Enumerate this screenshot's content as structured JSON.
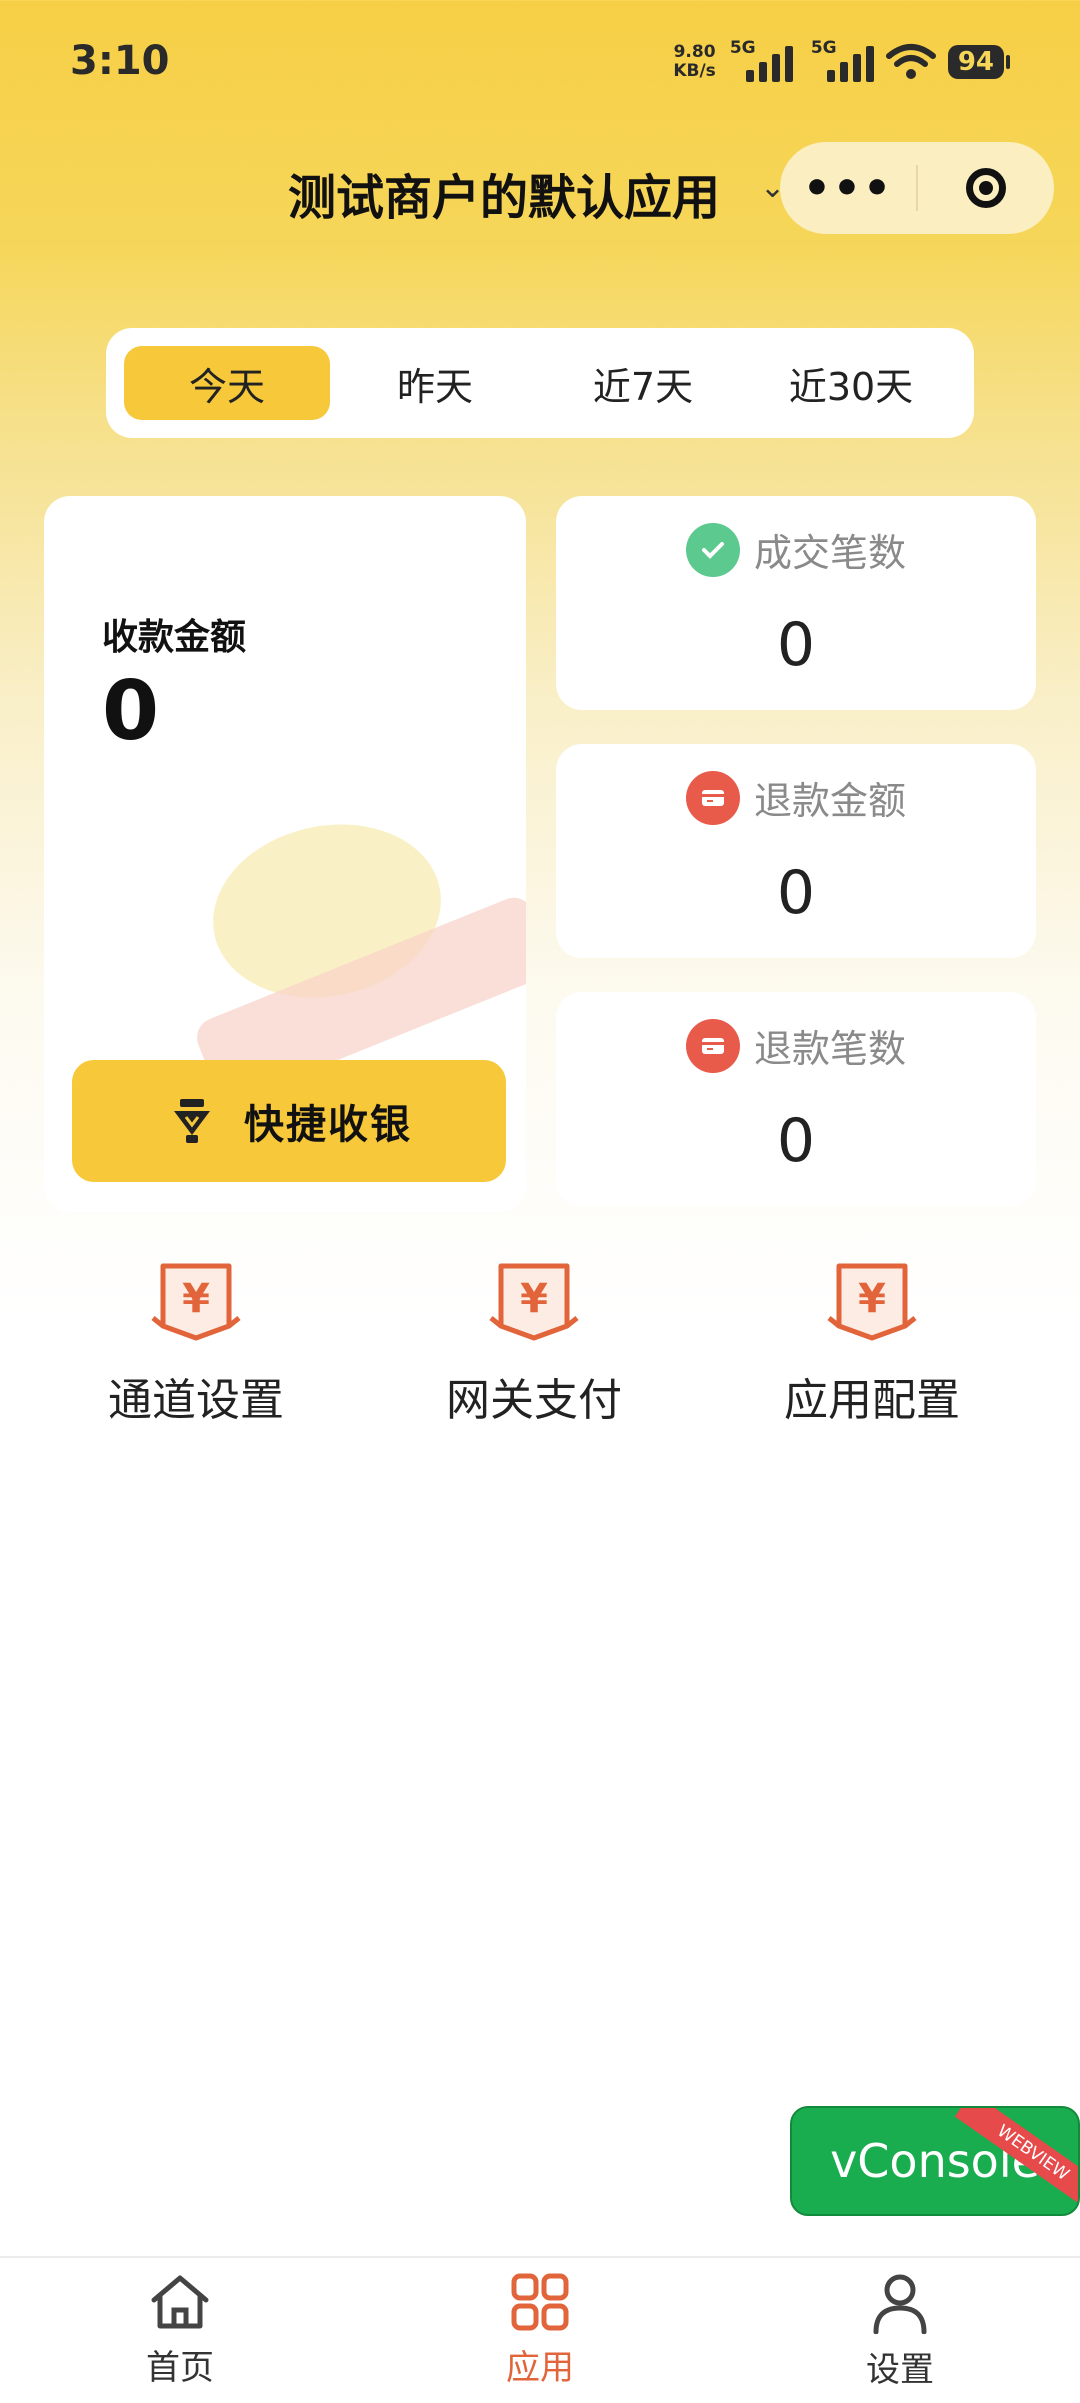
{
  "status_bar": {
    "time": "3:10",
    "net_speed_value": "9.80",
    "net_speed_unit": "KB/s",
    "signal1_tag": "5G",
    "signal2_tag": "5G",
    "battery": "94"
  },
  "header": {
    "title": "测试商户的默认应用",
    "more_icon": "more-dots-icon",
    "close_icon": "target-icon"
  },
  "tabs": {
    "items": [
      "今天",
      "昨天",
      "近7天",
      "近30天"
    ],
    "active_index": 0
  },
  "summary": {
    "amount_label": "收款金额",
    "amount_value": "0",
    "quick_cashier_label": "快捷收银",
    "cards": [
      {
        "label": "成交笔数",
        "value": "0",
        "icon": "check-circle-icon",
        "color": "#5cc98f"
      },
      {
        "label": "退款金额",
        "value": "0",
        "icon": "refund-card-icon",
        "color": "#e85a4a"
      },
      {
        "label": "退款笔数",
        "value": "0",
        "icon": "refund-card-icon",
        "color": "#e85a4a"
      }
    ]
  },
  "shortcuts": [
    {
      "label": "通道设置",
      "icon": "yuan-tag-icon"
    },
    {
      "label": "网关支付",
      "icon": "yuan-tag-icon"
    },
    {
      "label": "应用配置",
      "icon": "yuan-tag-icon"
    }
  ],
  "vconsole": {
    "label": "vConsole",
    "ribbon": "WEBVIEW"
  },
  "bottom_nav": {
    "items": [
      {
        "label": "首页",
        "icon": "home-icon"
      },
      {
        "label": "应用",
        "icon": "apps-grid-icon"
      },
      {
        "label": "设置",
        "icon": "user-icon"
      }
    ],
    "active_index": 1
  },
  "colors": {
    "accent": "#f6c83a",
    "icon_orange": "#e2643a",
    "success_green": "#5cc98f",
    "refund_red": "#e85a4a",
    "vconsole_green": "#1aad4f"
  }
}
